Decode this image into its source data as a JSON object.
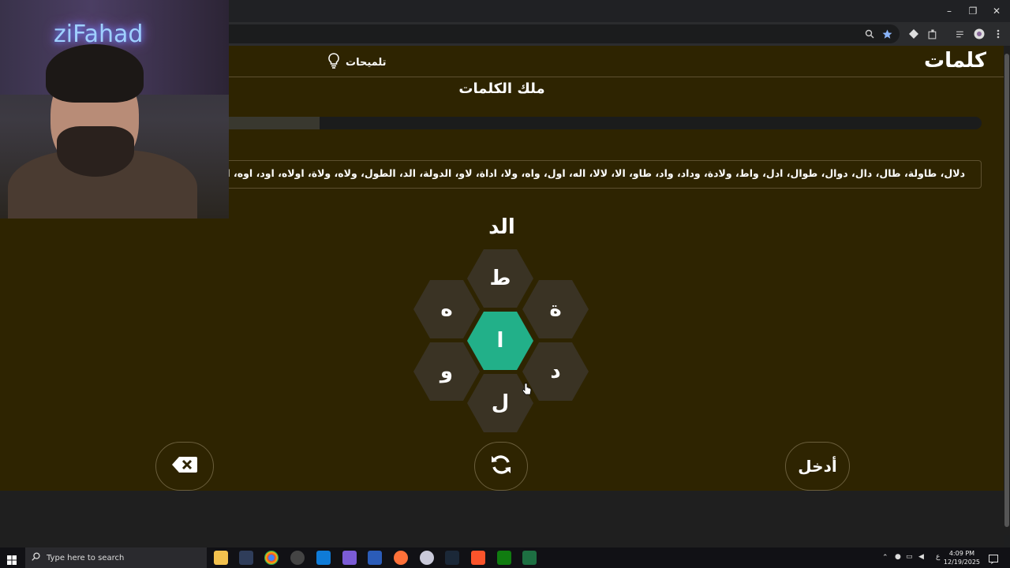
{
  "browser": {
    "window_controls": {
      "minimize": "–",
      "restore": "❐",
      "close": "✕"
    }
  },
  "game": {
    "brand": "كلمات",
    "hints_label": "تلميحات",
    "rank_title": "ملك الكلمات",
    "progress_fraction": 0.13,
    "found_words": "دلال، طاولة، طال، دال، دوال، طوال، ادل، واط، ولادة، وداد، واد، طاو، الا، لالا، اله، اول، واه، ولا، اداة، لاو، الدولة، الد، الطول، ولاه، ولاة، اولاه، اود، اوه، اطلال، اطال، الطاولة",
    "current_word": "الد",
    "letters": {
      "top": "ط",
      "upper_left": "ه",
      "upper_right": "ة",
      "center": "ا",
      "lower_left": "و",
      "lower_right": "د",
      "bottom": "ل"
    },
    "enter_label": "أدخل",
    "colors": {
      "background": "#2e2401",
      "center_hex": "#22b089",
      "outer_hex": "#3a3324"
    }
  },
  "webcam": {
    "neon_text": "ziFahad"
  },
  "taskbar": {
    "search_placeholder": "Type here to search",
    "time": "4:09 PM",
    "date": "12/19/2025",
    "lang": "ع"
  }
}
